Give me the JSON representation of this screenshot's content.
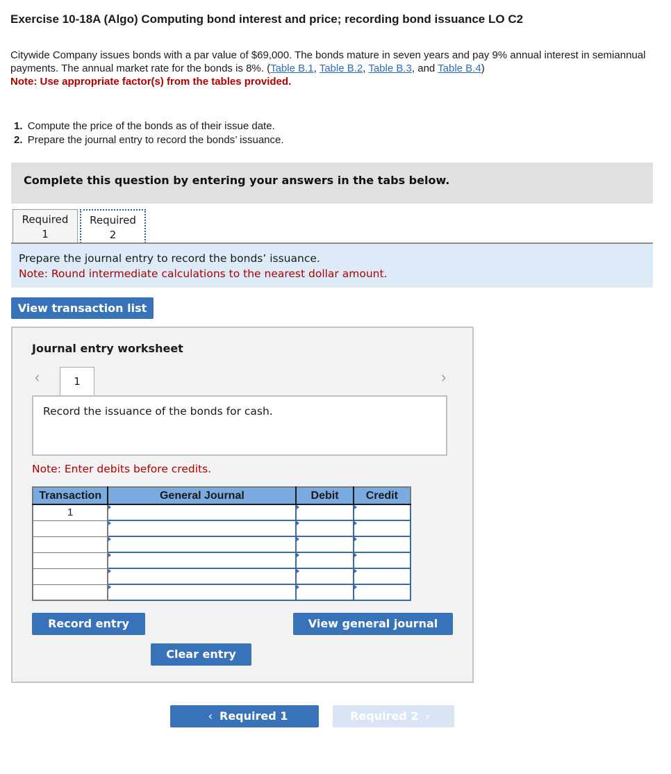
{
  "title": "Exercise 10-18A (Algo) Computing bond interest and price; recording bond issuance LO C2",
  "intro": {
    "text": "Citywide Company issues bonds with a par value of $69,000. The bonds mature in seven years and pay 9% annual interest in semiannual payments. The annual market rate for the bonds is 8%. (",
    "links": [
      "Table B.1",
      "Table B.2",
      "Table B.3",
      "Table B.4"
    ],
    "sep1": ", ",
    "sep2": ", ",
    "sep3": ", and ",
    "close": ")",
    "note": "Note: Use appropriate factor(s) from the tables provided."
  },
  "steps": [
    {
      "num": "1.",
      "text": "Compute the price of the bonds as of their issue date."
    },
    {
      "num": "2.",
      "text": "Prepare the journal entry to record the bonds’ issuance."
    }
  ],
  "complete_bar": "Complete this question by entering your answers in the tabs below.",
  "tabs": [
    {
      "line1": "Required",
      "line2": "1",
      "active": false
    },
    {
      "line1": "Required",
      "line2": "2",
      "active": true
    }
  ],
  "instructions": {
    "text": "Prepare the journal entry to record the bonds’ issuance.",
    "note": "Note: Round intermediate calculations to the nearest dollar amount."
  },
  "view_transaction_list": "View transaction list",
  "worksheet": {
    "title": "Journal entry worksheet",
    "page": "1",
    "prev_icon": "‹",
    "next_icon": "›",
    "description": "Record the issuance of the bonds for cash.",
    "note": "Note: Enter debits before credits.",
    "columns": [
      "Transaction",
      "General Journal",
      "Debit",
      "Credit"
    ],
    "rows": [
      {
        "transaction": "1",
        "account": "",
        "debit": "",
        "credit": ""
      },
      {
        "transaction": "",
        "account": "",
        "debit": "",
        "credit": ""
      },
      {
        "transaction": "",
        "account": "",
        "debit": "",
        "credit": ""
      },
      {
        "transaction": "",
        "account": "",
        "debit": "",
        "credit": ""
      },
      {
        "transaction": "",
        "account": "",
        "debit": "",
        "credit": ""
      },
      {
        "transaction": "",
        "account": "",
        "debit": "",
        "credit": ""
      }
    ],
    "record_entry": "Record entry",
    "clear_entry": "Clear entry",
    "view_general_journal": "View general journal"
  },
  "nav": {
    "prev_label": "Required 1",
    "next_label": "Required 2",
    "prev_icon": "‹",
    "next_icon": "›"
  },
  "colors": {
    "button_blue": "#3872b8",
    "note_red": "#b00000",
    "link_blue": "#2a6ebb",
    "table_header": "#7aabe0",
    "instruction_bg": "#dcebf7"
  }
}
